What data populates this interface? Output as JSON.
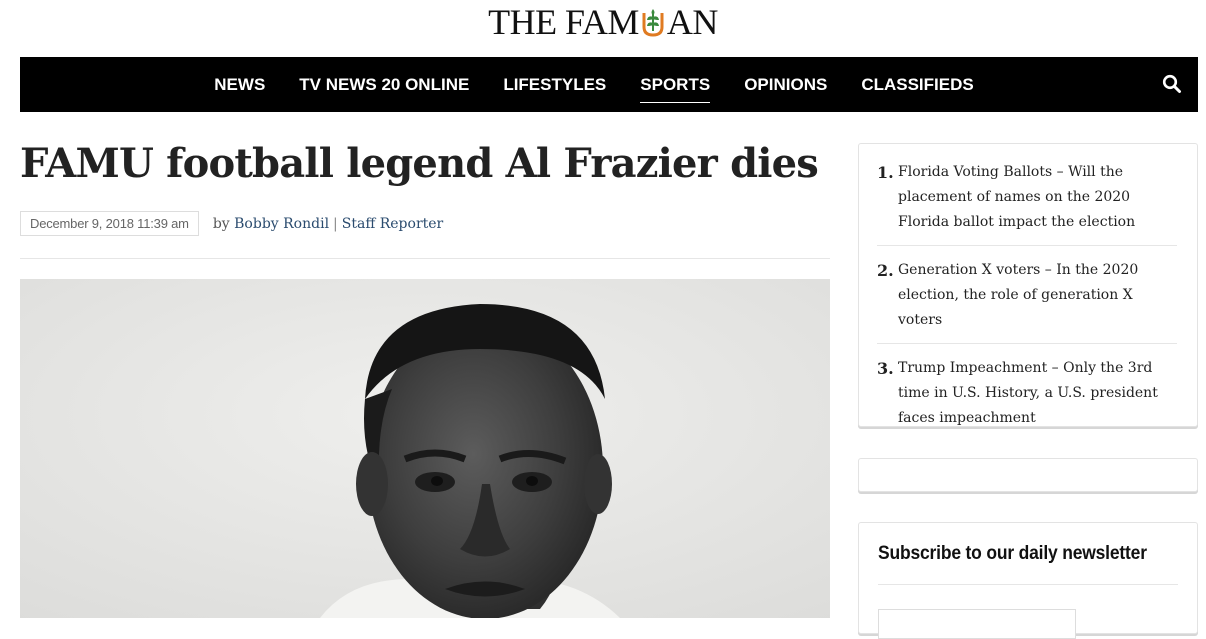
{
  "masthead": {
    "logo_left": "THE FAM",
    "logo_right": "AN",
    "logo_mark": "famu-rattler-leaf-mark"
  },
  "nav": {
    "items": [
      {
        "label": "NEWS"
      },
      {
        "label": "TV NEWS 20 ONLINE"
      },
      {
        "label": "LIFESTYLES"
      },
      {
        "label": "SPORTS",
        "active": true
      },
      {
        "label": "OPINIONS"
      },
      {
        "label": "CLASSIFIEDS"
      }
    ],
    "search_icon": "search-icon"
  },
  "article": {
    "headline": "FAMU football legend Al Frazier dies",
    "date": "December 9, 2018 11:39 am",
    "by": "by",
    "author": "Bobby Rondil",
    "separator": "|",
    "role": "Staff Reporter"
  },
  "sidebar": {
    "trending": [
      {
        "num": "1.",
        "text": "Florida Voting Ballots – Will the placement of names on the 2020 Florida ballot impact the election"
      },
      {
        "num": "2.",
        "text": "Generation X voters – In the 2020 election, the role of generation X voters"
      },
      {
        "num": "3.",
        "text": "Trump Impeachment – Only the 3rd time in U.S. History, a U.S. president faces impeachment"
      }
    ],
    "newsletter_title": "Subscribe to our daily newsletter"
  },
  "colors": {
    "nav_bg": "#000000",
    "link": "#2a4b6e",
    "logo_orange": "#e07b22",
    "logo_green": "#3b8a3e"
  }
}
